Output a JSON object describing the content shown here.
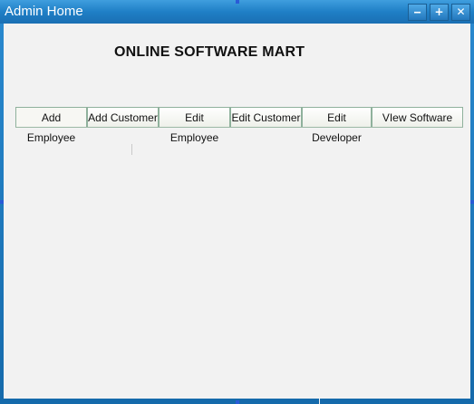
{
  "window": {
    "title": "Admin Home",
    "controls": {
      "minimize": "‒",
      "maximize": "+",
      "close": "✕"
    }
  },
  "main": {
    "heading": "ONLINE SOFTWARE MART",
    "tabs": [
      {
        "label": "Add Employee"
      },
      {
        "label": "Add Customer"
      },
      {
        "label": "Edit Employee"
      },
      {
        "label": "Edit Customer"
      },
      {
        "label": "Edit Developer"
      },
      {
        "label": "VIew Software"
      }
    ]
  }
}
